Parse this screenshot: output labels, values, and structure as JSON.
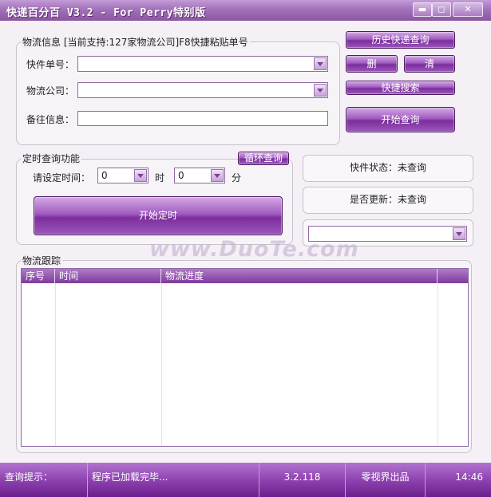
{
  "window": {
    "title": "快递百分百 V3.2 - For Perry特别版",
    "minimize": "▬",
    "restore": "◻",
    "close": "✕"
  },
  "logistics_info": {
    "group_label": "物流信息 [当前支持:127家物流公司]F8快捷粘贴单号",
    "tracking_label": "快件单号：",
    "company_label": "物流公司：",
    "remark_label": "备往信息：",
    "tracking_value": "",
    "company_value": "",
    "remark_value": ""
  },
  "buttons": {
    "history": "历史快递查询",
    "delete": "删",
    "clear": "清",
    "quick_search": "快捷搜索",
    "start_query": "开始查询",
    "loop_query": "循环查询",
    "start_timer": "开始定时"
  },
  "timer": {
    "group_label": "定时查询功能",
    "set_time_label": "请设定时间：",
    "hour_value": "0",
    "hour_unit": "时",
    "minute_value": "0",
    "minute_unit": "分"
  },
  "status": {
    "package_status": "快件状态：未查询",
    "updated_status": "是否更新：未查询",
    "dropdown_value": ""
  },
  "tracking": {
    "group_label": "物流跟踪",
    "columns": [
      "序号",
      "时间",
      "物流进度"
    ],
    "rows": []
  },
  "statusbar": {
    "label": "查询提示：",
    "message": "程序已加载完毕...",
    "version": "3.2.118",
    "publisher": "零视界出品",
    "time": "14:46"
  },
  "watermark": "www.DuoTe.com",
  "colors": {
    "accent": "#8a4aa8",
    "title_bar": "#a271ba",
    "status_bar": "#8f43b0"
  },
  "icons": {
    "dropdown": "chevron-down-icon"
  }
}
